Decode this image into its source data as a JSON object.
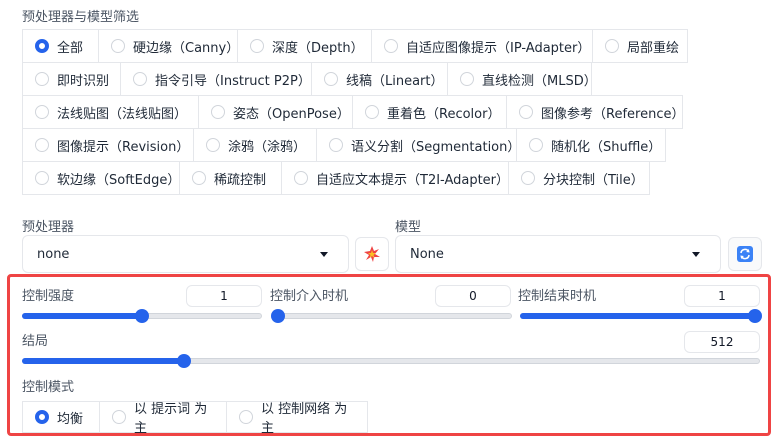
{
  "preprocessor_filter": {
    "label": "预处理器与模型筛选",
    "rows": [
      [
        {
          "label": "全部",
          "checked": true
        },
        {
          "label": "硬边缘（Canny）",
          "checked": false
        },
        {
          "label": "深度（Depth）",
          "checked": false
        },
        {
          "label": "自适应图像提示（IP-Adapter）",
          "checked": false
        },
        {
          "label": "局部重绘",
          "checked": false
        }
      ],
      [
        {
          "label": "即时识别",
          "checked": false
        },
        {
          "label": "指令引导（Instruct P2P）",
          "checked": false
        },
        {
          "label": "线稿（Lineart）",
          "checked": false
        },
        {
          "label": "直线检测（MLSD）",
          "checked": false
        }
      ],
      [
        {
          "label": "法线贴图（法线贴图）",
          "checked": false
        },
        {
          "label": "姿态（OpenPose）",
          "checked": false
        },
        {
          "label": "重着色（Recolor）",
          "checked": false
        },
        {
          "label": "图像参考（Reference）",
          "checked": false
        }
      ],
      [
        {
          "label": "图像提示（Revision）",
          "checked": false
        },
        {
          "label": "涂鸦（涂鸦）",
          "checked": false
        },
        {
          "label": "语义分割（Segmentation）",
          "checked": false
        },
        {
          "label": "随机化（Shuffle）",
          "checked": false
        }
      ],
      [
        {
          "label": "软边缘（SoftEdge）",
          "checked": false
        },
        {
          "label": "稀疏控制",
          "checked": false
        },
        {
          "label": "自适应文本提示（T2I-Adapter）",
          "checked": false
        },
        {
          "label": "分块控制（Tile）",
          "checked": false
        }
      ]
    ]
  },
  "preprocessor": {
    "label": "预处理器",
    "value": "none",
    "run_icon": "explosion-icon"
  },
  "model": {
    "label": "模型",
    "value": "None",
    "refresh_icon": "refresh-icon"
  },
  "controls": {
    "weight": {
      "label": "控制强度",
      "value": "1",
      "fraction": 0.5
    },
    "start": {
      "label": "控制介入时机",
      "value": "0",
      "fraction": 0.0
    },
    "end": {
      "label": "控制结束时机",
      "value": "1",
      "fraction": 1.0
    },
    "resolution": {
      "label": "结局",
      "value": "512",
      "fraction": 0.22
    },
    "mode_label": "控制模式",
    "modes": [
      {
        "label": "均衡",
        "checked": true
      },
      {
        "label": "以 提示词 为主",
        "checked": false
      },
      {
        "label": "以 控制网络 为主",
        "checked": false
      }
    ]
  },
  "colors": {
    "accent": "#2563eb",
    "highlight": "#ef4444"
  }
}
